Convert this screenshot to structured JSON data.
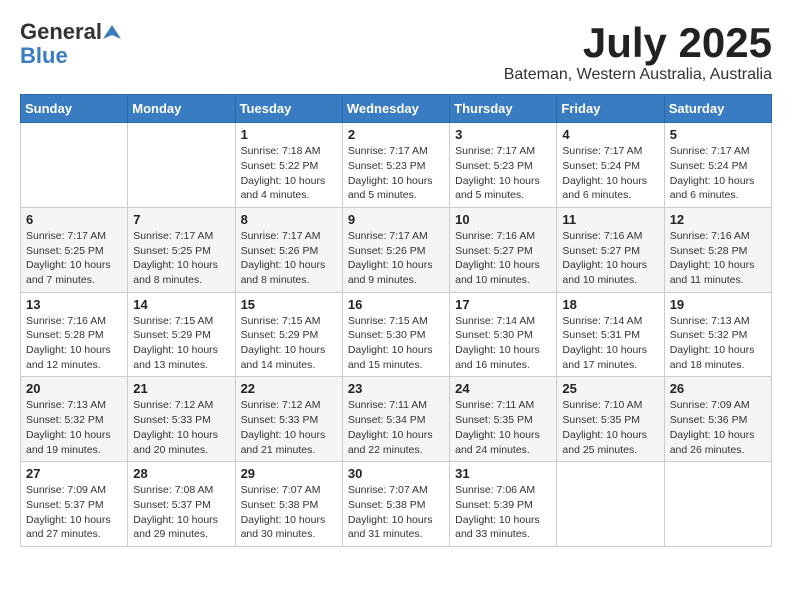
{
  "header": {
    "logo_general": "General",
    "logo_blue": "Blue",
    "month_title": "July 2025",
    "location": "Bateman, Western Australia, Australia"
  },
  "days_of_week": [
    "Sunday",
    "Monday",
    "Tuesday",
    "Wednesday",
    "Thursday",
    "Friday",
    "Saturday"
  ],
  "weeks": [
    [
      {
        "day": "",
        "info": ""
      },
      {
        "day": "",
        "info": ""
      },
      {
        "day": "1",
        "info": "Sunrise: 7:18 AM\nSunset: 5:22 PM\nDaylight: 10 hours and 4 minutes."
      },
      {
        "day": "2",
        "info": "Sunrise: 7:17 AM\nSunset: 5:23 PM\nDaylight: 10 hours and 5 minutes."
      },
      {
        "day": "3",
        "info": "Sunrise: 7:17 AM\nSunset: 5:23 PM\nDaylight: 10 hours and 5 minutes."
      },
      {
        "day": "4",
        "info": "Sunrise: 7:17 AM\nSunset: 5:24 PM\nDaylight: 10 hours and 6 minutes."
      },
      {
        "day": "5",
        "info": "Sunrise: 7:17 AM\nSunset: 5:24 PM\nDaylight: 10 hours and 6 minutes."
      }
    ],
    [
      {
        "day": "6",
        "info": "Sunrise: 7:17 AM\nSunset: 5:25 PM\nDaylight: 10 hours and 7 minutes."
      },
      {
        "day": "7",
        "info": "Sunrise: 7:17 AM\nSunset: 5:25 PM\nDaylight: 10 hours and 8 minutes."
      },
      {
        "day": "8",
        "info": "Sunrise: 7:17 AM\nSunset: 5:26 PM\nDaylight: 10 hours and 8 minutes."
      },
      {
        "day": "9",
        "info": "Sunrise: 7:17 AM\nSunset: 5:26 PM\nDaylight: 10 hours and 9 minutes."
      },
      {
        "day": "10",
        "info": "Sunrise: 7:16 AM\nSunset: 5:27 PM\nDaylight: 10 hours and 10 minutes."
      },
      {
        "day": "11",
        "info": "Sunrise: 7:16 AM\nSunset: 5:27 PM\nDaylight: 10 hours and 10 minutes."
      },
      {
        "day": "12",
        "info": "Sunrise: 7:16 AM\nSunset: 5:28 PM\nDaylight: 10 hours and 11 minutes."
      }
    ],
    [
      {
        "day": "13",
        "info": "Sunrise: 7:16 AM\nSunset: 5:28 PM\nDaylight: 10 hours and 12 minutes."
      },
      {
        "day": "14",
        "info": "Sunrise: 7:15 AM\nSunset: 5:29 PM\nDaylight: 10 hours and 13 minutes."
      },
      {
        "day": "15",
        "info": "Sunrise: 7:15 AM\nSunset: 5:29 PM\nDaylight: 10 hours and 14 minutes."
      },
      {
        "day": "16",
        "info": "Sunrise: 7:15 AM\nSunset: 5:30 PM\nDaylight: 10 hours and 15 minutes."
      },
      {
        "day": "17",
        "info": "Sunrise: 7:14 AM\nSunset: 5:30 PM\nDaylight: 10 hours and 16 minutes."
      },
      {
        "day": "18",
        "info": "Sunrise: 7:14 AM\nSunset: 5:31 PM\nDaylight: 10 hours and 17 minutes."
      },
      {
        "day": "19",
        "info": "Sunrise: 7:13 AM\nSunset: 5:32 PM\nDaylight: 10 hours and 18 minutes."
      }
    ],
    [
      {
        "day": "20",
        "info": "Sunrise: 7:13 AM\nSunset: 5:32 PM\nDaylight: 10 hours and 19 minutes."
      },
      {
        "day": "21",
        "info": "Sunrise: 7:12 AM\nSunset: 5:33 PM\nDaylight: 10 hours and 20 minutes."
      },
      {
        "day": "22",
        "info": "Sunrise: 7:12 AM\nSunset: 5:33 PM\nDaylight: 10 hours and 21 minutes."
      },
      {
        "day": "23",
        "info": "Sunrise: 7:11 AM\nSunset: 5:34 PM\nDaylight: 10 hours and 22 minutes."
      },
      {
        "day": "24",
        "info": "Sunrise: 7:11 AM\nSunset: 5:35 PM\nDaylight: 10 hours and 24 minutes."
      },
      {
        "day": "25",
        "info": "Sunrise: 7:10 AM\nSunset: 5:35 PM\nDaylight: 10 hours and 25 minutes."
      },
      {
        "day": "26",
        "info": "Sunrise: 7:09 AM\nSunset: 5:36 PM\nDaylight: 10 hours and 26 minutes."
      }
    ],
    [
      {
        "day": "27",
        "info": "Sunrise: 7:09 AM\nSunset: 5:37 PM\nDaylight: 10 hours and 27 minutes."
      },
      {
        "day": "28",
        "info": "Sunrise: 7:08 AM\nSunset: 5:37 PM\nDaylight: 10 hours and 29 minutes."
      },
      {
        "day": "29",
        "info": "Sunrise: 7:07 AM\nSunset: 5:38 PM\nDaylight: 10 hours and 30 minutes."
      },
      {
        "day": "30",
        "info": "Sunrise: 7:07 AM\nSunset: 5:38 PM\nDaylight: 10 hours and 31 minutes."
      },
      {
        "day": "31",
        "info": "Sunrise: 7:06 AM\nSunset: 5:39 PM\nDaylight: 10 hours and 33 minutes."
      },
      {
        "day": "",
        "info": ""
      },
      {
        "day": "",
        "info": ""
      }
    ]
  ]
}
